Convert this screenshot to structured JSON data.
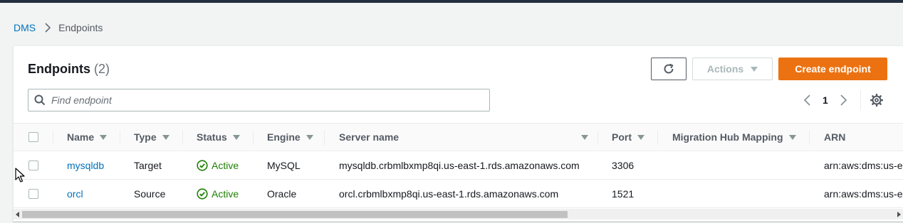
{
  "breadcrumb": {
    "parent": "DMS",
    "current": "Endpoints"
  },
  "panel": {
    "title": "Endpoints",
    "count": "(2)"
  },
  "buttons": {
    "actions": "Actions",
    "create": "Create endpoint"
  },
  "search": {
    "placeholder": "Find endpoint",
    "value": ""
  },
  "pagination": {
    "page": "1"
  },
  "table": {
    "columns": [
      "Name",
      "Type",
      "Status",
      "Engine",
      "Server name",
      "Port",
      "Migration Hub Mapping",
      "ARN"
    ],
    "rows": [
      {
        "name": "mysqldb",
        "type": "Target",
        "status": "Active",
        "engine": "MySQL",
        "server": "mysqldb.crbmlbxmp8qi.us-east-1.rds.amazonaws.com",
        "port": "3306",
        "mapping": "",
        "arn": "arn:aws:dms:us-e"
      },
      {
        "name": "orcl",
        "type": "Source",
        "status": "Active",
        "engine": "Oracle",
        "server": "orcl.crbmlbxmp8qi.us-east-1.rds.amazonaws.com",
        "port": "1521",
        "mapping": "",
        "arn": "arn:aws:dms:us-e"
      }
    ]
  },
  "colors": {
    "primary": "#ec7211",
    "link": "#0073bb",
    "success": "#1d8102",
    "header_bar": "#232f3e"
  },
  "icons": [
    "chevron-right-icon",
    "refresh-icon",
    "caret-down-icon",
    "search-icon",
    "chevron-left-icon",
    "gear-icon",
    "sort-caret-icon",
    "status-success-icon",
    "mouse-cursor-icon"
  ]
}
